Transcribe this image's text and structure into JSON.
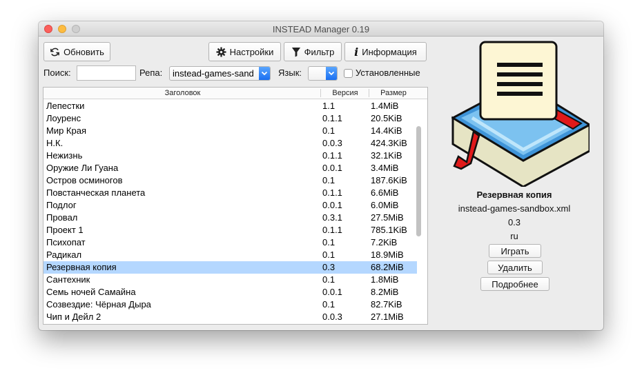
{
  "window": {
    "title": "INSTEAD Manager 0.19"
  },
  "toolbar": {
    "refresh_label": "Обновить",
    "settings_label": "Настройки",
    "filter_label": "Фильтр",
    "info_label": "Информация"
  },
  "filters": {
    "search_label": "Поиск:",
    "search_value": "",
    "repo_label": "Репа:",
    "repo_value": "instead-games-sand",
    "lang_label": "Язык:",
    "lang_value": "",
    "installed_label": "Установленные",
    "installed_checked": false
  },
  "table": {
    "columns": [
      "Заголовок",
      "Версия",
      "Размер"
    ],
    "rows": [
      {
        "title": "Лепестки",
        "version": "1.1",
        "size": "1.4MiB"
      },
      {
        "title": "Лоуренс",
        "version": "0.1.1",
        "size": "20.5KiB"
      },
      {
        "title": "Мир Края",
        "version": "0.1",
        "size": "14.4KiB"
      },
      {
        "title": "Н.К.",
        "version": "0.0.3",
        "size": "424.3KiB"
      },
      {
        "title": "Нежизнь",
        "version": "0.1.1",
        "size": "32.1KiB"
      },
      {
        "title": "Оружие Ли Гуана",
        "version": "0.0.1",
        "size": "3.4MiB"
      },
      {
        "title": "Остров осминогов",
        "version": "0.1",
        "size": "187.6KiB"
      },
      {
        "title": "Повстанческая планета",
        "version": "0.1.1",
        "size": "6.6MiB"
      },
      {
        "title": "Подлог",
        "version": "0.0.1",
        "size": "6.0MiB"
      },
      {
        "title": "Провал",
        "version": "0.3.1",
        "size": "27.5MiB"
      },
      {
        "title": "Проект 1",
        "version": "0.1.1",
        "size": "785.1KiB"
      },
      {
        "title": "Психопат",
        "version": "0.1",
        "size": "7.2KiB"
      },
      {
        "title": "Радикал",
        "version": "0.1",
        "size": "18.9MiB"
      },
      {
        "title": "Резервная копия",
        "version": "0.3",
        "size": "68.2MiB",
        "selected": true
      },
      {
        "title": "Сантехник",
        "version": "0.1",
        "size": "1.8MiB"
      },
      {
        "title": "Семь ночей Самайна",
        "version": "0.0.1",
        "size": "8.2MiB"
      },
      {
        "title": "Созвездие: Чёрная Дыра",
        "version": "0.1",
        "size": "82.7KiB"
      },
      {
        "title": "Чип и Дейл 2",
        "version": "0.0.3",
        "size": "27.1MiB"
      }
    ]
  },
  "details": {
    "title": "Резервная копия",
    "repo": "instead-games-sandbox.xml",
    "version": "0.3",
    "lang": "ru",
    "play_label": "Играть",
    "delete_label": "Удалить",
    "more_label": "Подробнее"
  },
  "colors": {
    "selection": "#b4d7ff",
    "accent": "#1a6ff1"
  },
  "icons": {
    "refresh": "refresh-icon",
    "settings": "gear-icon",
    "filter": "filter-icon",
    "info": "info-icon",
    "game": "book-icon"
  }
}
